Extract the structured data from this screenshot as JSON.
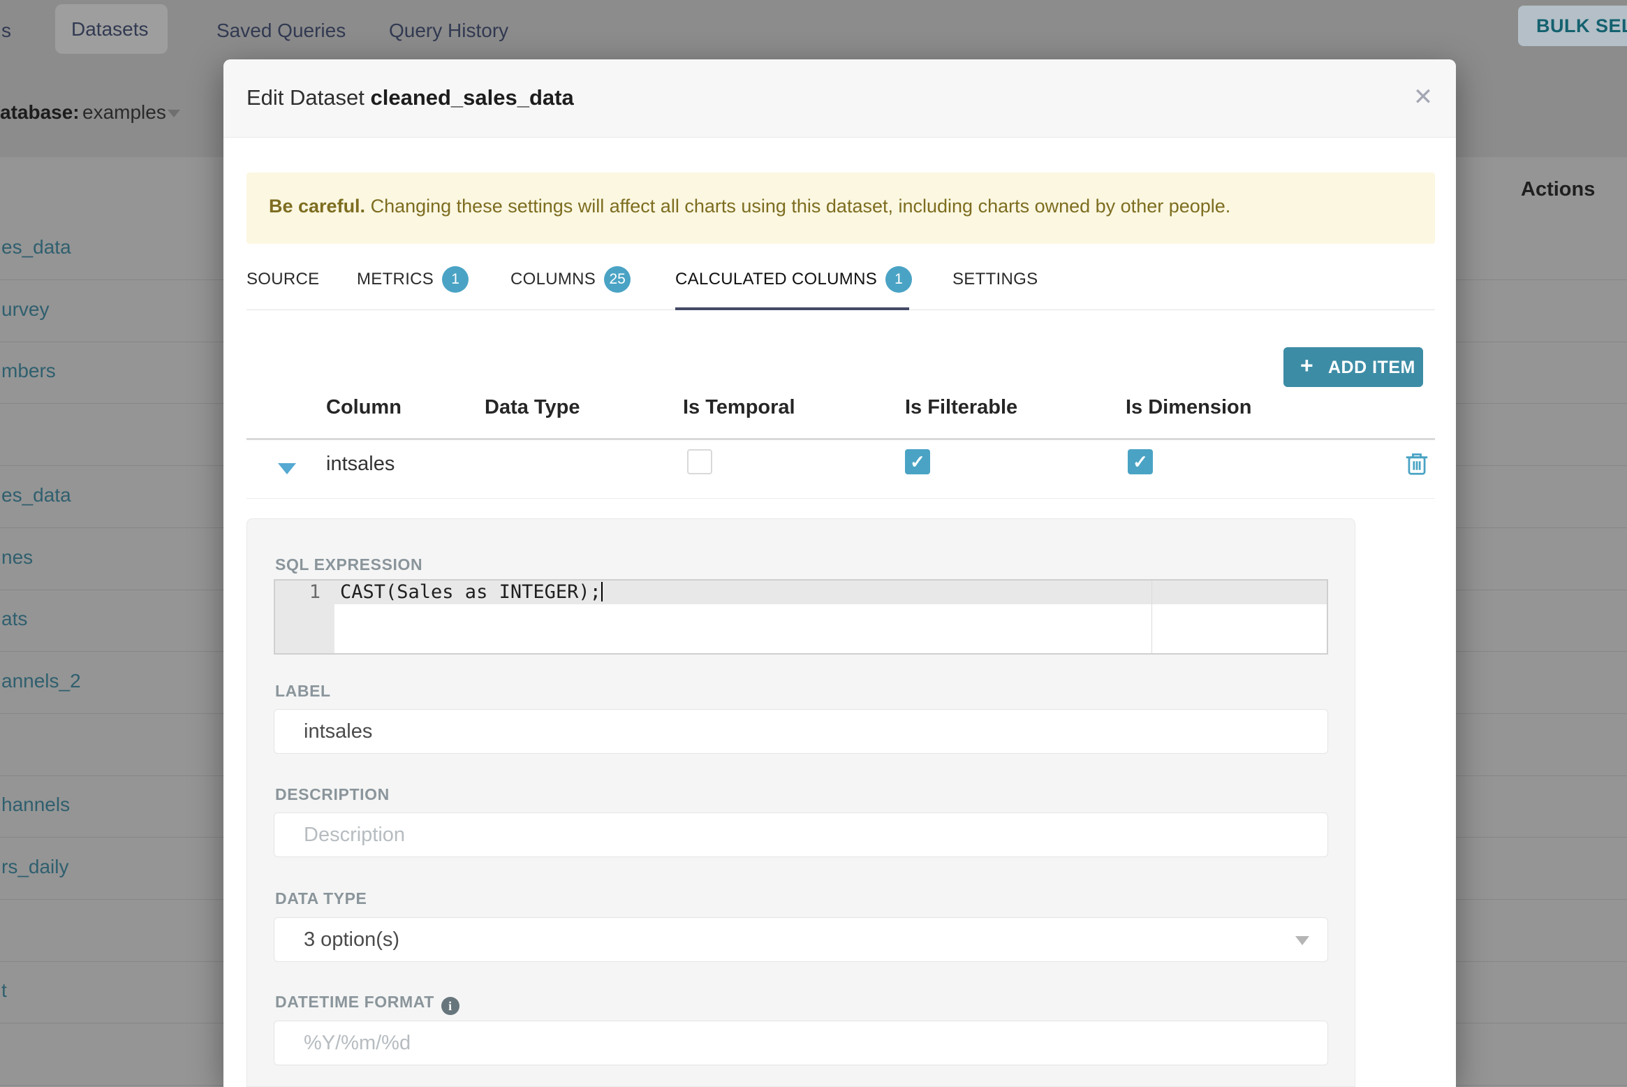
{
  "page": {
    "nav": {
      "edge_fragment": "s",
      "active_tab": "Datasets",
      "tab_saved": "Saved Queries",
      "tab_history": "Query History",
      "bulk_button": "BULK SELE"
    },
    "filter_bar": {
      "database_label_fragment": "atabase:",
      "database_value": "examples"
    },
    "table": {
      "actions_header": "Actions",
      "row_fragments": [
        "es_data",
        "urvey",
        "mbers",
        "",
        "es_data",
        "nes",
        "ats",
        "annels_2",
        "",
        "hannels",
        "rs_daily",
        "",
        "t",
        ""
      ]
    },
    "colors": {
      "link_dimmed": "#2f5f6e"
    }
  },
  "modal": {
    "title_prefix": "Edit Dataset ",
    "title_dataset": "cleaned_sales_data",
    "close_icon": "✕",
    "warning": {
      "bold": "Be careful.",
      "text": " Changing these settings will affect all charts using this dataset, including charts owned by other people."
    },
    "tabs": [
      {
        "label": "SOURCE"
      },
      {
        "label": "METRICS",
        "badge": "1"
      },
      {
        "label": "COLUMNS",
        "badge": "25"
      },
      {
        "label": "CALCULATED COLUMNS",
        "badge": "1",
        "active": true
      },
      {
        "label": "SETTINGS"
      }
    ],
    "add_item": {
      "icon": "+",
      "label": "ADD ITEM"
    },
    "table": {
      "headers": [
        "Column",
        "Data Type",
        "Is Temporal",
        "Is Filterable",
        "Is Dimension"
      ],
      "row": {
        "name": "intsales",
        "is_temporal": false,
        "is_filterable": true,
        "is_dimension": true
      },
      "check_glyph": "✓"
    },
    "detail": {
      "sql_label": "SQL EXPRESSION",
      "sql_line_number": "1",
      "sql_code": "CAST(Sales as INTEGER);",
      "label_label": "LABEL",
      "label_value": "intsales",
      "description_label": "DESCRIPTION",
      "description_placeholder": "Description",
      "datatype_label": "DATA TYPE",
      "datatype_value": "3 option(s)",
      "datetime_label": "DATETIME FORMAT",
      "datetime_info": "i",
      "datetime_placeholder": "%Y/%m/%d"
    },
    "colors": {
      "accent_button": "#3d8ca6",
      "badge": "#4aa3c4",
      "active_underline": "#434a67",
      "banner_bg": "#fbf7e1",
      "banner_text": "#7d6d20"
    }
  }
}
